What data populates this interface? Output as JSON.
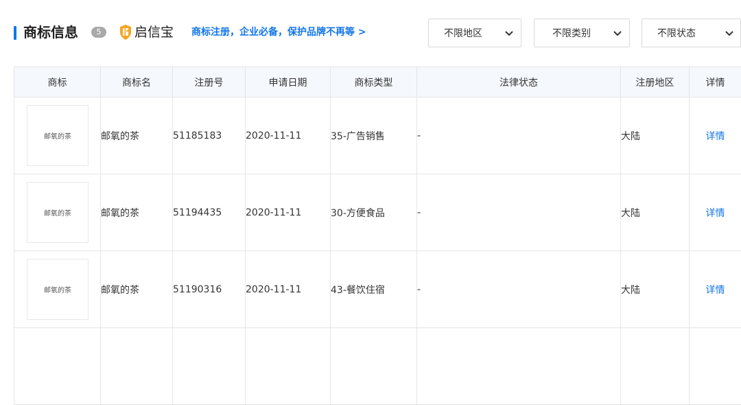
{
  "header": {
    "title": "商标信息",
    "count": "5",
    "brand_name": "启信宝",
    "promo": "商标注册，企业必备，保护品牌不再等 >",
    "accent_color": "#1276e8",
    "brand_icon_color": "#f5a623"
  },
  "filters": {
    "region": "不限地区",
    "category": "不限类别",
    "status": "不限状态"
  },
  "table": {
    "columns": [
      "商标",
      "商标名",
      "注册号",
      "申请日期",
      "商标类型",
      "法律状态",
      "注册地区",
      "详情"
    ],
    "rows": [
      {
        "logo_text": "邮氧的茶",
        "name": "邮氧的茶",
        "reg_no": "51185183",
        "date": "2020-11-11",
        "type": "35-广告销售",
        "legal_status": "-",
        "region": "大陆",
        "detail": "详情"
      },
      {
        "logo_text": "邮氧的茶",
        "name": "邮氧的茶",
        "reg_no": "51194435",
        "date": "2020-11-11",
        "type": "30-方便食品",
        "legal_status": "-",
        "region": "大陆",
        "detail": "详情"
      },
      {
        "logo_text": "邮氧的茶",
        "name": "邮氧的茶",
        "reg_no": "51190316",
        "date": "2020-11-11",
        "type": "43-餐饮住宿",
        "legal_status": "-",
        "region": "大陆",
        "detail": "详情"
      }
    ]
  }
}
